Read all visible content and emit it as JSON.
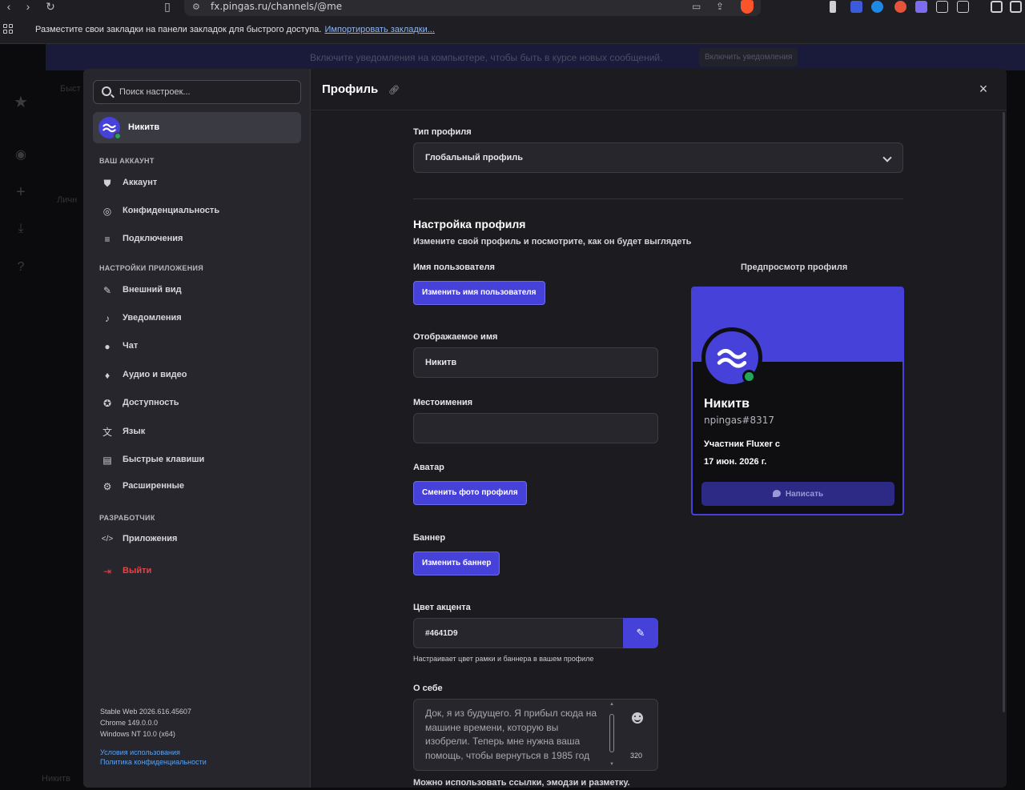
{
  "browser": {
    "url": "fx.pingas.ru/channels/@me",
    "bookmarks_prompt": "Разместите свои закладки на панели закладок для быстрого доступа.",
    "import_link": "Импортировать закладки..."
  },
  "background_app": {
    "notification_text": "Включите уведомления на компьютере, чтобы быть в курсе новых сообщений.",
    "notification_button": "Включить уведомления",
    "ghost_quick": "Быст",
    "ghost_personal": "Личн",
    "ghost_user": "Никитв"
  },
  "sidebar": {
    "search_placeholder": "Поиск настроек...",
    "user_name": "Никитв",
    "sections": [
      {
        "title": "Ваш аккаунт",
        "items": [
          {
            "label": "Аккаунт",
            "icon": "shield-icon"
          },
          {
            "label": "Конфиденциальность",
            "icon": "eye-off-icon"
          },
          {
            "label": "Подключения",
            "icon": "connections-icon"
          }
        ]
      },
      {
        "title": "Настройки приложения",
        "items": [
          {
            "label": "Внешний вид",
            "icon": "brush-icon"
          },
          {
            "label": "Уведомления",
            "icon": "bell-icon"
          },
          {
            "label": "Чат",
            "icon": "chat-icon"
          },
          {
            "label": "Аудио и видео",
            "icon": "microphone-icon"
          },
          {
            "label": "Доступность",
            "icon": "accessibility-icon"
          },
          {
            "label": "Язык",
            "icon": "translate-icon"
          },
          {
            "label": "Быстрые клавиши",
            "icon": "keyboard-icon"
          },
          {
            "label": "Расширенные",
            "icon": "gear-icon"
          }
        ]
      },
      {
        "title": "Разработчик",
        "items": [
          {
            "label": "Приложения",
            "icon": "code-icon"
          }
        ]
      }
    ],
    "logout_label": "Выйти",
    "version_lines": [
      "Stable Web 2026.616.45607",
      "Chrome 149.0.0.0",
      "Windows NT 10.0 (x64)"
    ],
    "terms_link": "Условия использования",
    "privacy_link": "Политика конфиденциальности"
  },
  "main": {
    "title": "Профиль",
    "profile_type_label": "Тип профиля",
    "profile_type_value": "Глобальный профиль",
    "section_title": "Настройка профиля",
    "section_subtitle": "Измените свой профиль и посмотрите, как он будет выглядеть",
    "username_label": "Имя пользователя",
    "username_button": "Изменить имя пользователя",
    "display_name_label": "Отображаемое имя",
    "display_name_value": "Никитв",
    "pronouns_label": "Местоимения",
    "pronouns_value": "",
    "avatar_label": "Аватар",
    "avatar_button": "Сменить фото профиля",
    "banner_label": "Баннер",
    "banner_button": "Изменить баннер",
    "accent_label": "Цвет акцента",
    "accent_value": "#4641D9",
    "accent_hint": "Настраивает цвет рамки и баннера в вашем профиле",
    "about_label": "О себе",
    "about_text": "Док, я из будущего. Я прибыл сюда на машине времени, которую вы изобрели. Теперь мне нужна ваша помощь, чтобы вернуться в 1985 год",
    "about_count": "320",
    "about_hint": "Можно использовать ссылки, эмодзи и разметку."
  },
  "preview": {
    "label": "Предпросмотр профиля",
    "name": "Никитв",
    "tag": "npingas#8317",
    "member_label": "Участник Fluxer с",
    "member_date": "17 июн. 2026 г.",
    "message_button": "Написать"
  },
  "colors": {
    "accent": "#4641D9",
    "online": "#23A55A",
    "danger": "#ED4245"
  }
}
